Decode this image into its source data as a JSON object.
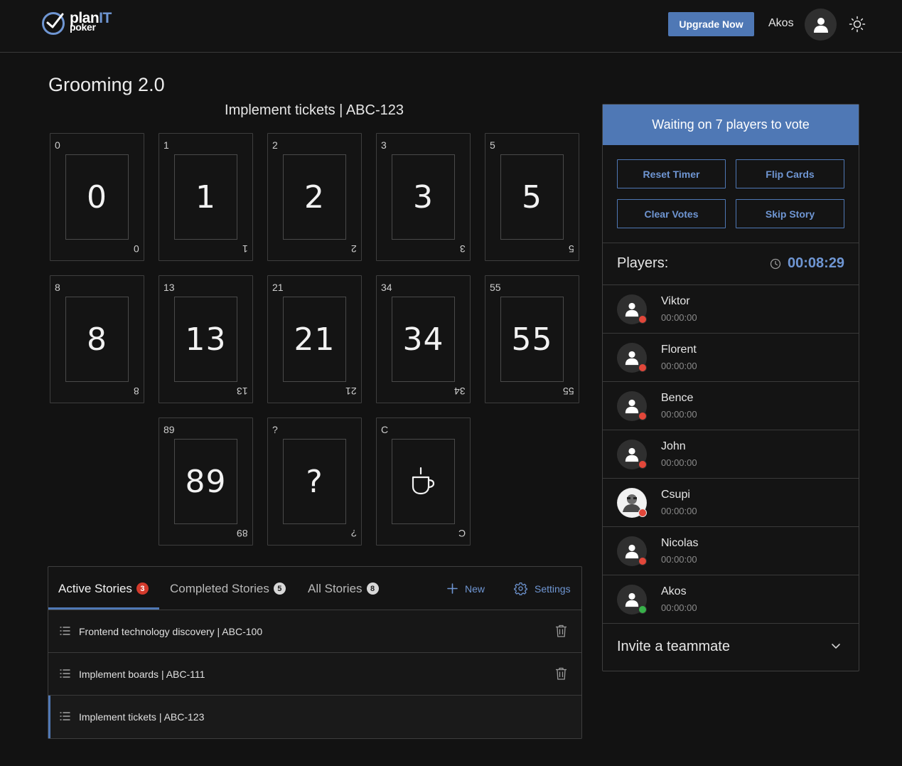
{
  "header": {
    "logo_plan": "plan",
    "logo_it": "IT",
    "logo_poker": "poker",
    "upgrade_label": "Upgrade Now",
    "username": "Akos",
    "avatar_icon": "user-icon",
    "theme_icon": "sun-icon"
  },
  "room": {
    "title": "Grooming 2.0",
    "current_story": "Implement tickets | ABC-123"
  },
  "cards": [
    {
      "corner": "0",
      "face": "0"
    },
    {
      "corner": "1",
      "face": "1"
    },
    {
      "corner": "2",
      "face": "2"
    },
    {
      "corner": "3",
      "face": "3"
    },
    {
      "corner": "5",
      "face": "5"
    },
    {
      "corner": "8",
      "face": "8"
    },
    {
      "corner": "13",
      "face": "13"
    },
    {
      "corner": "21",
      "face": "21"
    },
    {
      "corner": "34",
      "face": "34"
    },
    {
      "corner": "55",
      "face": "55"
    },
    {
      "corner": "89",
      "face": "89"
    },
    {
      "corner": "?",
      "face": "?"
    },
    {
      "corner": "C",
      "face": "",
      "icon": "coffee-cup-icon"
    }
  ],
  "stories": {
    "tabs": [
      {
        "label": "Active Stories",
        "count": "3",
        "badge_color": "#d33a2c"
      },
      {
        "label": "Completed Stories",
        "count": "5",
        "badge_color": "#d8d8d8"
      },
      {
        "label": "All Stories",
        "count": "8",
        "badge_color": "#d8d8d8"
      }
    ],
    "new_label": "New",
    "settings_label": "Settings",
    "items": [
      {
        "title": "Frontend technology discovery | ABC-100"
      },
      {
        "title": "Implement boards | ABC-111"
      },
      {
        "title": "Implement tickets | ABC-123"
      }
    ]
  },
  "panel": {
    "status": "Waiting on 7 players to vote",
    "buttons": {
      "reset_timer": "Reset Timer",
      "flip_cards": "Flip Cards",
      "clear_votes": "Clear Votes",
      "skip_story": "Skip Story"
    },
    "players_label": "Players:",
    "timer": "00:08:29",
    "players": [
      {
        "name": "Viktor",
        "time": "00:00:00",
        "status": "red"
      },
      {
        "name": "Florent",
        "time": "00:00:00",
        "status": "red"
      },
      {
        "name": "Bence",
        "time": "00:00:00",
        "status": "red"
      },
      {
        "name": "John",
        "time": "00:00:00",
        "status": "red"
      },
      {
        "name": "Csupi",
        "time": "00:00:00",
        "status": "red"
      },
      {
        "name": "Nicolas",
        "time": "00:00:00",
        "status": "red"
      },
      {
        "name": "Akos",
        "time": "00:00:00",
        "status": "green"
      }
    ],
    "invite_label": "Invite a teammate"
  },
  "colors": {
    "accent": "#4f78b5",
    "accent_text": "#6f96d3",
    "status_red": "#e2473a",
    "status_green": "#38b24a"
  }
}
